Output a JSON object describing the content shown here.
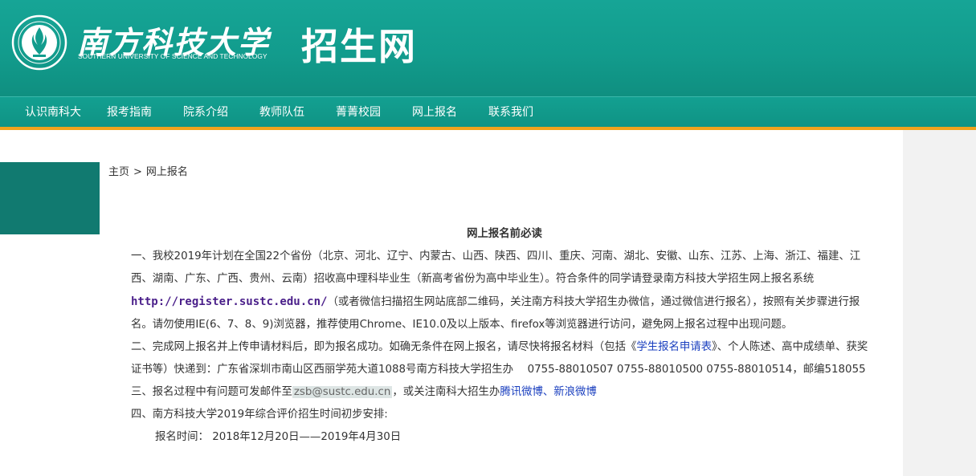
{
  "header": {
    "school_cn": "南方科技大学",
    "school_en": "SOUTHERN UNIVERSITY OF SCIENCE AND TECHNOLOGY",
    "site_title": "招生网"
  },
  "nav": {
    "items": [
      "认识南科大",
      "报考指南",
      "院系介绍",
      "教师队伍",
      "菁菁校园",
      "网上报名",
      "联系我们"
    ]
  },
  "breadcrumb": {
    "home": "主页",
    "separator": ">",
    "current": "网上报名"
  },
  "article": {
    "title": "网上报名前必读",
    "p1_a": "一、我校2019年计划在全国22个省份（北京、河北、辽宁、内蒙古、山西、陕西、四川、重庆、河南、湖北、安徽、山东、江苏、上海、浙江、福建、江西、湖南、广东、广西、贵州、云南）招收高中理科毕业生（新高考省份为高中毕业生）。符合条件的同学请登录南方科技大学招生网上报名系统",
    "p1_link": "http://register.sustc.edu.cn/",
    "p1_b": "（或者微信扫描招生网站底部二维码，关注南方科技大学招生办微信，通过微信进行报名），按照有关步骤进行报名。请勿使用IE(6、7、8、9)浏览器，推荐使用Chrome、IE10.0及以上版本、firefox等浏览器进行访问，避免网上报名过程中出现问题。",
    "p2_a": "二、完成网上报名并上传申请材料后，即为报名成功。如确无条件在网上报名，请尽快将报名材料（包括《",
    "p2_link": "学生报名申请表",
    "p2_b": "》、个人陈述、高中成绩单、获奖证书等）快递到：广东省深圳市南山区西丽学苑大道1088号南方科技大学招生办　 0755-88010507  0755-88010500 0755-88010514，邮编518055",
    "p3_a": "三、报名过程中有问题可发邮件至",
    "p3_email": "zsb@sustc.edu.cn",
    "p3_b": "，或关注南科大招生办",
    "p3_link1": "腾讯微博",
    "p3_sep": "、",
    "p3_link2": "新浪微博",
    "p4": "四、南方科技大学2019年综合评价招生时间初步安排:",
    "p5": "报名时间： 2018年12月20日——2019年4月30日"
  },
  "colors": {
    "header_teal": "#129c8d",
    "nav_accent": "#f0a31c",
    "left_block": "#117a70",
    "link_purple": "#4a1f8a",
    "link_blue": "#1a3fbf"
  }
}
